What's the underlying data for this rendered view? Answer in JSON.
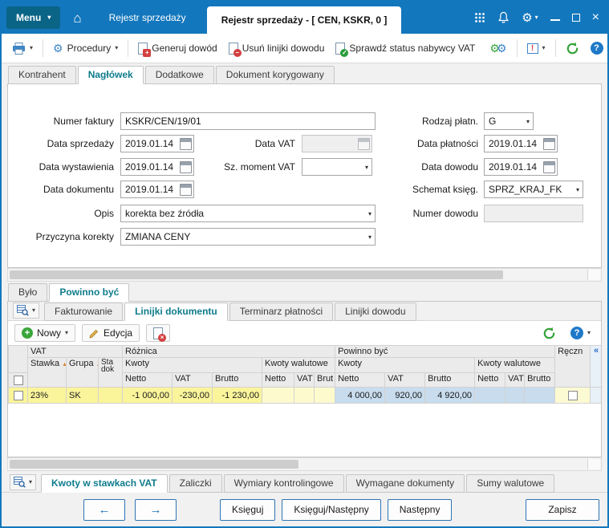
{
  "colors": {
    "accent_blue": "#1377bd",
    "active_tab_teal": "#0e7c8c",
    "row_yellow": "#faf49b",
    "selection_blue": "#c8dcee",
    "refresh_green": "#35a33a"
  },
  "titlebar": {
    "menu_label": "Menu",
    "background_tab": "Rejestr sprzedaży",
    "active_tab": "Rejestr sprzedaży - [ CEN, KSKR, 0 ]"
  },
  "toolbar": {
    "procedury_label": "Procedury",
    "generuj_dowod_label": "Generuj dowód",
    "usun_linijki_label": "Usuń linijki dowodu",
    "sprawdz_status_label": "Sprawdź status nabywcy VAT"
  },
  "main_tabs": {
    "kontrahent": "Kontrahent",
    "naglowek": "Nagłówek",
    "dodatkowe": "Dodatkowe",
    "dokument_korygowany": "Dokument korygowany"
  },
  "form": {
    "numer_faktury_label": "Numer faktury",
    "numer_faktury_value": "KSKR/CEN/19/01",
    "data_sprzedazy_label": "Data sprzedaży",
    "data_sprzedazy_value": "2019.01.14",
    "data_wystawienia_label": "Data wystawienia",
    "data_wystawienia_value": "2019.01.14",
    "data_dokumentu_label": "Data dokumentu",
    "data_dokumentu_value": "2019.01.14",
    "opis_label": "Opis",
    "opis_value": "korekta bez źródła",
    "przyczyna_label": "Przyczyna korekty",
    "przyczyna_value": "ZMIANA CENY",
    "data_vat_label": "Data VAT",
    "data_vat_value": "",
    "sz_moment_vat_label": "Sz. moment VAT",
    "sz_moment_vat_value": "",
    "rodzaj_platn_label": "Rodzaj płatn.",
    "rodzaj_platn_value": "G",
    "data_platnosci_label": "Data płatności",
    "data_platnosci_value": "2019.01.14",
    "data_dowodu_label": "Data dowodu",
    "data_dowodu_value": "2019.01.14",
    "schemat_ksieg_label": "Schemat księg.",
    "schemat_ksieg_value": "SPRZ_KRAJ_FK",
    "numer_dowodu_label": "Numer dowodu",
    "numer_dowodu_value": ""
  },
  "mid_tabs": {
    "bylo": "Było",
    "powinno_byc": "Powinno być"
  },
  "detail_tabs": {
    "fakturowanie": "Fakturowanie",
    "linijki_dokumentu": "Linijki dokumentu",
    "terminarz_platnosci": "Terminarz płatności",
    "linijki_dowodu": "Linijki dowodu"
  },
  "detail_toolbar": {
    "nowy": "Nowy",
    "edycja": "Edycja"
  },
  "grid": {
    "groups": {
      "vat": "VAT",
      "roznica": "Różnica",
      "powinno_byc": "Powinno być",
      "recznie": "Ręczn"
    },
    "columns": {
      "stawka": "Stawka",
      "stawka_sort": "1",
      "grupa": "Grupa",
      "grupa_sort": "2",
      "sta_dok": "Sta dok",
      "kwoty": "Kwoty",
      "kwoty_walutowe": "Kwoty walutowe",
      "netto": "Netto",
      "vat": "VAT",
      "brutto": "Brutto",
      "brut": "Brut"
    },
    "row": {
      "stawka": "23%",
      "grupa": "SK",
      "roznica_netto": "-1 000,00",
      "roznica_vat": "-230,00",
      "roznica_brutto": "-1 230,00",
      "powinno_netto": "4 000,00",
      "powinno_vat": "920,00",
      "powinno_brutto": "4 920,00"
    }
  },
  "bottom_tabs": {
    "kwoty_w_stawkach": "Kwoty w stawkach VAT",
    "zaliczki": "Zaliczki",
    "wymiary": "Wymiary kontrolingowe",
    "wymagane": "Wymagane dokumenty",
    "sumy_walutowe": "Sumy walutowe"
  },
  "bottom_buttons": {
    "ksieguj": "Księguj",
    "ksieguj_nastepny": "Księguj/Następny",
    "nastepny": "Następny",
    "zapisz": "Zapisz"
  }
}
